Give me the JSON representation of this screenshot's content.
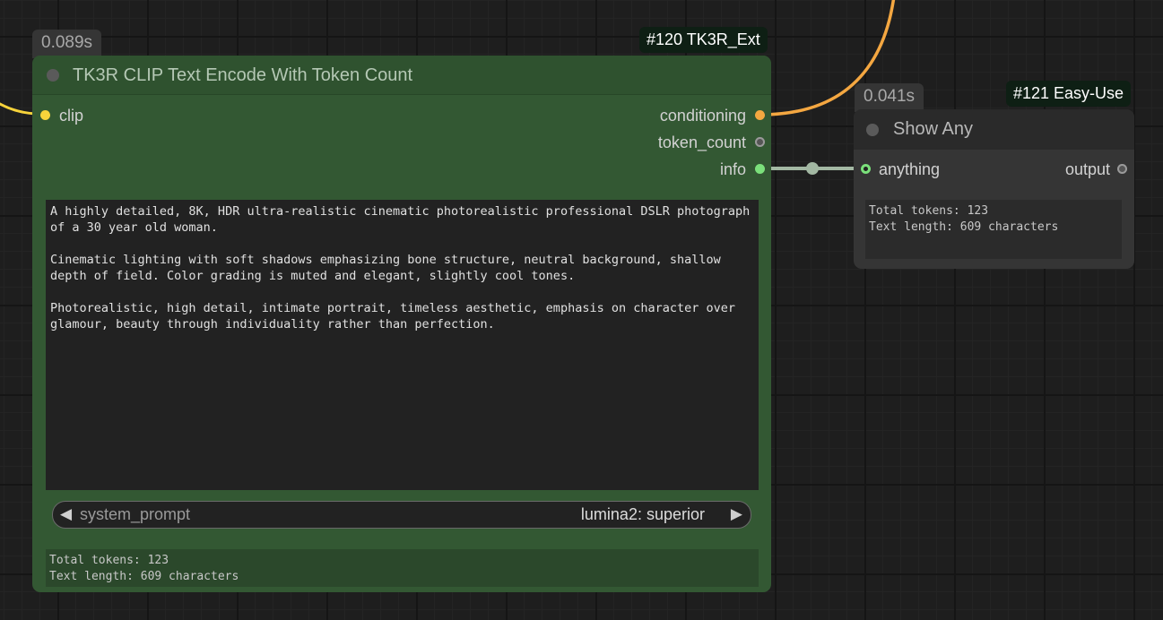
{
  "node120": {
    "time": "0.089s",
    "badge": "#120 TK3R_Ext",
    "title": "TK3R CLIP Text Encode With Token Count",
    "input_clip": "clip",
    "output_conditioning": "conditioning",
    "output_token_count": "token_count",
    "output_info": "info",
    "prompt_text": "A highly detailed, 8K, HDR ultra-realistic cinematic photorealistic professional DSLR photograph of a 30 year old woman.\n\nCinematic lighting with soft shadows emphasizing bone structure, neutral background, shallow depth of field. Color grading is muted and elegant, slightly cool tones.\n\nPhotorealistic, high detail, intimate portrait, timeless aesthetic, emphasis on character over glamour, beauty through individuality rather than perfection.",
    "combo_label": "system_prompt",
    "combo_value": "lumina2: superior",
    "combo_left_arrow": "◀",
    "combo_right_arrow": "▶",
    "info_text": "Total tokens: 123\nText length: 609 characters"
  },
  "node121": {
    "time": "0.041s",
    "badge": "#121 Easy-Use",
    "title": "Show Any",
    "input_anything": "anything",
    "output_output": "output",
    "display_text": "Total tokens: 123\nText length: 609 characters"
  },
  "colors": {
    "canvas": "#1e1e1e",
    "node120_body": "#335833",
    "node120_title": "#2f522f",
    "node121_body": "#353535",
    "node121_title": "#2a2a2a",
    "clip_wire": "#f7d33b",
    "conditioning_wire": "#f4a741",
    "info_wire": "#a3b8a3",
    "id_badge_bg": "#0e1f14"
  }
}
